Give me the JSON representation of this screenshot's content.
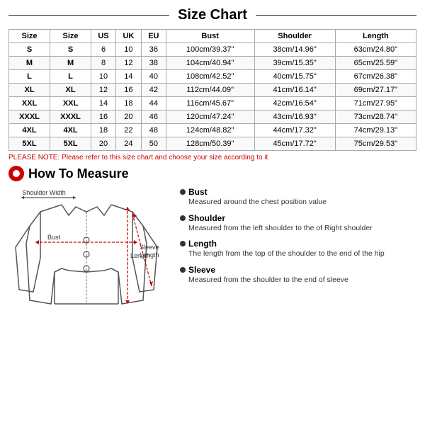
{
  "title": "Size Chart",
  "table": {
    "headers": [
      "Size",
      "Size",
      "US",
      "UK",
      "EU",
      "Bust",
      "Shoulder",
      "Length"
    ],
    "rows": [
      [
        "S",
        "S",
        "6",
        "10",
        "36",
        "100cm/39.37\"",
        "38cm/14.96\"",
        "63cm/24.80\""
      ],
      [
        "M",
        "M",
        "8",
        "12",
        "38",
        "104cm/40.94\"",
        "39cm/15.35\"",
        "65cm/25.59\""
      ],
      [
        "L",
        "L",
        "10",
        "14",
        "40",
        "108cm/42.52\"",
        "40cm/15.75\"",
        "67cm/26.38\""
      ],
      [
        "XL",
        "XL",
        "12",
        "16",
        "42",
        "112cm/44.09\"",
        "41cm/16.14\"",
        "69cm/27.17\""
      ],
      [
        "XXL",
        "XXL",
        "14",
        "18",
        "44",
        "116cm/45.67\"",
        "42cm/16.54\"",
        "71cm/27.95\""
      ],
      [
        "XXXL",
        "XXXL",
        "16",
        "20",
        "46",
        "120cm/47.24\"",
        "43cm/16.93\"",
        "73cm/28.74\""
      ],
      [
        "4XL",
        "4XL",
        "18",
        "22",
        "48",
        "124cm/48.82\"",
        "44cm/17.32\"",
        "74cm/29.13\""
      ],
      [
        "5XL",
        "5XL",
        "20",
        "24",
        "50",
        "128cm/50.39\"",
        "45cm/17.72\"",
        "75cm/29.53\""
      ]
    ]
  },
  "note": "PLEASE NOTE: Please refer to this size chart and choose your size according to it",
  "how_to_measure": {
    "title": "How To Measure",
    "items": [
      {
        "label": "Bust",
        "desc": "Measured around the chest position value"
      },
      {
        "label": "Shoulder",
        "desc": "Measured from the left shoulder to the of Right shoulder"
      },
      {
        "label": "Length",
        "desc": "The length from the top of the shoulder to the end of the hip"
      },
      {
        "label": "Sleeve",
        "desc": "Measured from the shoulder to the end of sleeve"
      }
    ]
  },
  "jacket_labels": {
    "shoulder_width": "Shoulder Width",
    "bust": "Bust",
    "sleeve_length": "Sleeve\nLength",
    "length": "Length"
  }
}
